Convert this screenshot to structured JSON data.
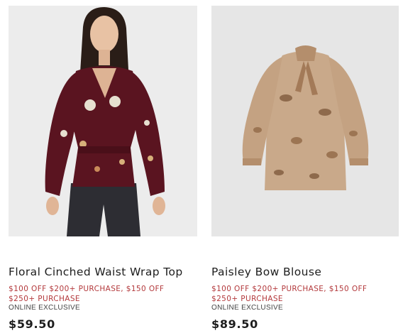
{
  "products": [
    {
      "image_alt": "Woman wearing a burgundy floral wrap top",
      "title": "Floral Cinched Waist Wrap Top",
      "promo": "$100 OFF $200+ PURCHASE, $150 OFF $250+ PURCHASE",
      "badge": "ONLINE EXCLUSIVE",
      "price": "$59.50",
      "colors": {
        "garment": "#5a1420",
        "background": "#ececec"
      }
    },
    {
      "image_alt": "Paisley print blouse with bow neck",
      "title": "Paisley Bow Blouse",
      "promo": "$100 OFF $200+ PURCHASE, $150 OFF $250+ PURCHASE",
      "badge": "ONLINE EXCLUSIVE",
      "price": "$89.50",
      "colors": {
        "garment": "#c9a98a",
        "background": "#e6e6e6"
      }
    }
  ],
  "promo_color": "#b3393c"
}
